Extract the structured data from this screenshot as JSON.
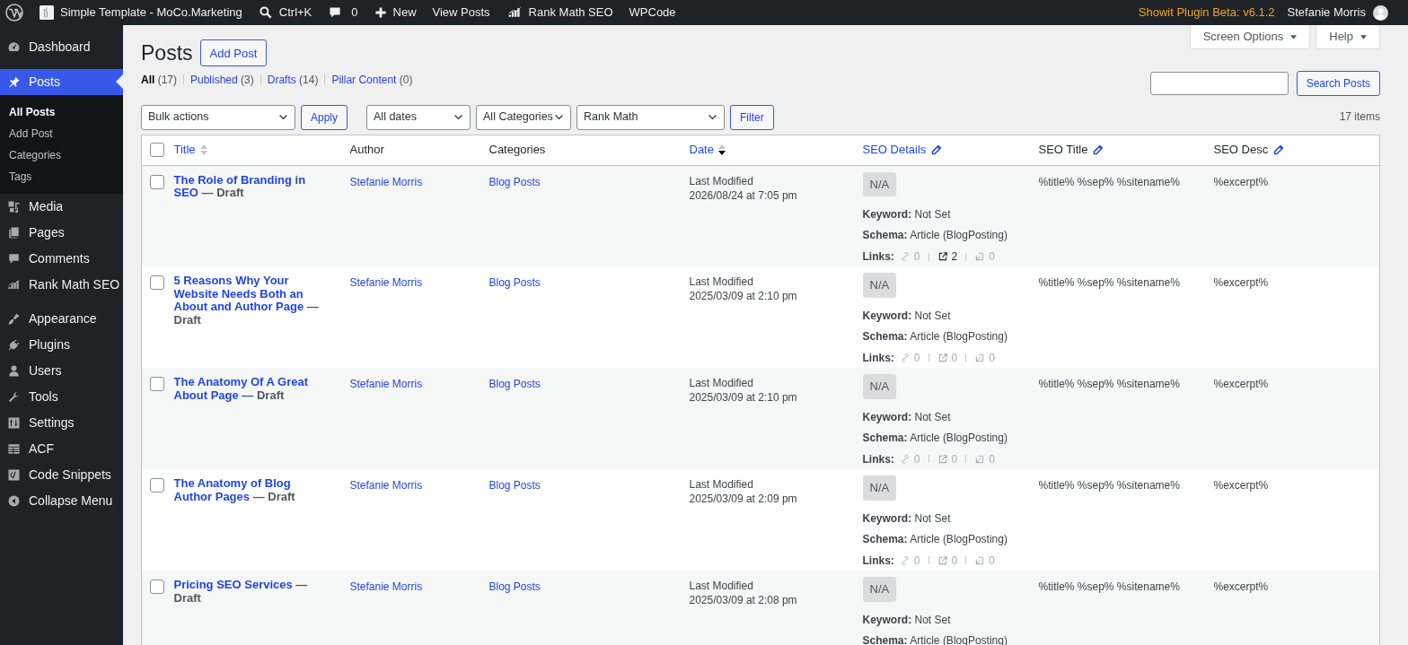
{
  "admin_bar": {
    "items": [
      {
        "kind": "wp-logo"
      },
      {
        "kind": "site",
        "label": "Simple Template - MoCo.Marketing"
      },
      {
        "kind": "search",
        "label": "Ctrl+K"
      },
      {
        "kind": "comments",
        "label": "0"
      },
      {
        "kind": "new",
        "label": "New"
      },
      {
        "kind": "text",
        "label": "View Posts"
      },
      {
        "kind": "rankmath",
        "label": "Rank Math SEO"
      },
      {
        "kind": "text",
        "label": "WPCode"
      }
    ],
    "notice": "Showit Plugin Beta: v6.1.2",
    "user": "Stefanie Morris"
  },
  "sidebar": {
    "groups": [
      {
        "items": [
          {
            "kind": "dashboard",
            "label": "Dashboard",
            "selected": false
          }
        ]
      },
      {
        "items": [
          {
            "kind": "pin",
            "label": "Posts",
            "selected": true,
            "submenu": [
              {
                "label": "All Posts",
                "selected": true
              },
              {
                "label": "Add Post",
                "selected": false
              },
              {
                "label": "Categories",
                "selected": false
              },
              {
                "label": "Tags",
                "selected": false
              }
            ]
          },
          {
            "kind": "media",
            "label": "Media",
            "selected": false
          },
          {
            "kind": "pages",
            "label": "Pages",
            "selected": false
          },
          {
            "kind": "comments",
            "label": "Comments",
            "selected": false
          },
          {
            "kind": "rankmath",
            "label": "Rank Math SEO",
            "selected": false
          }
        ]
      },
      {
        "items": [
          {
            "kind": "appearance",
            "label": "Appearance",
            "selected": false
          },
          {
            "kind": "plugins",
            "label": "Plugins",
            "selected": false
          },
          {
            "kind": "users",
            "label": "Users",
            "selected": false
          },
          {
            "kind": "tools",
            "label": "Tools",
            "selected": false
          },
          {
            "kind": "settings",
            "label": "Settings",
            "selected": false
          },
          {
            "kind": "acf",
            "label": "ACF",
            "selected": false
          },
          {
            "kind": "code",
            "label": "Code Snippets",
            "selected": false
          },
          {
            "kind": "collapse",
            "label": "Collapse Menu",
            "selected": false
          }
        ]
      }
    ]
  },
  "screen_tabs": [
    "Screen Options",
    "Help"
  ],
  "page_title": "Posts",
  "add_button": "Add Post",
  "status_filters": [
    {
      "label": "All",
      "count": "(17)",
      "selected": true
    },
    {
      "label": "Published",
      "count": "(3)",
      "selected": false
    },
    {
      "label": "Drafts",
      "count": "(14)",
      "selected": false
    },
    {
      "label": "Pillar Content",
      "count": "(0)",
      "selected": false
    }
  ],
  "search_button": "Search Posts",
  "toolbar": {
    "bulk": "Bulk actions",
    "apply": "Apply",
    "dates": "All dates",
    "categories": "All Categories",
    "rank_math": "Rank Math",
    "filter": "Filter",
    "count": "17 items"
  },
  "table": {
    "select_all_checked": false,
    "columns": [
      {
        "label": "Title",
        "link": true,
        "sortable": true,
        "sorted": false,
        "edit": false
      },
      {
        "label": "Author",
        "link": false,
        "sortable": false,
        "edit": false
      },
      {
        "label": "Categories",
        "link": false,
        "sortable": false,
        "edit": false
      },
      {
        "label": "Date",
        "link": true,
        "sortable": true,
        "sorted": true,
        "edit": false
      },
      {
        "label": "SEO Details",
        "link": true,
        "sortable": false,
        "edit": true
      },
      {
        "label": "SEO Title",
        "link": false,
        "sortable": false,
        "edit": true
      },
      {
        "label": "SEO Desc",
        "link": false,
        "sortable": false,
        "edit": true
      }
    ],
    "rows": [
      {
        "checked": false,
        "title": "The Role of Branding in SEO",
        "state": "— Draft",
        "author": "Stefanie Morris",
        "category": "Blog Posts",
        "date_label": "Last Modified",
        "date": "2026/08/24 at 7:05 pm",
        "score": "N/A",
        "keyword": "**Keyword:** Not Set",
        "schema": "**Schema:** Article (BlogPosting)",
        "links_label": "Links:",
        "links": [
          {
            "kind": "internal",
            "count": "0",
            "active": false
          },
          {
            "kind": "external",
            "count": "2",
            "active": true
          },
          {
            "kind": "incoming",
            "count": "0",
            "active": false
          }
        ],
        "seo_title": "%title% %sep% %sitename%",
        "seo_desc": "%excerpt%"
      },
      {
        "checked": false,
        "title": "5 Reasons Why Your Website Needs Both an About and Author Page",
        "state": "— Draft",
        "author": "Stefanie Morris",
        "category": "Blog Posts",
        "date_label": "Last Modified",
        "date": "2025/03/09 at 2:10 pm",
        "score": "N/A",
        "keyword": "**Keyword:** Not Set",
        "schema": "**Schema:** Article (BlogPosting)",
        "links_label": "Links:",
        "links": [
          {
            "kind": "internal",
            "count": "0",
            "active": false
          },
          {
            "kind": "external",
            "count": "0",
            "active": false
          },
          {
            "kind": "incoming",
            "count": "0",
            "active": false
          }
        ],
        "seo_title": "%title% %sep% %sitename%",
        "seo_desc": "%excerpt%"
      },
      {
        "checked": false,
        "title": "The Anatomy Of A Great About Page",
        "state": "— Draft",
        "author": "Stefanie Morris",
        "category": "Blog Posts",
        "date_label": "Last Modified",
        "date": "2025/03/09 at 2:10 pm",
        "score": "N/A",
        "keyword": "**Keyword:** Not Set",
        "schema": "**Schema:** Article (BlogPosting)",
        "links_label": "Links:",
        "links": [
          {
            "kind": "internal",
            "count": "0",
            "active": false
          },
          {
            "kind": "external",
            "count": "0",
            "active": false
          },
          {
            "kind": "incoming",
            "count": "0",
            "active": false
          }
        ],
        "seo_title": "%title% %sep% %sitename%",
        "seo_desc": "%excerpt%"
      },
      {
        "checked": false,
        "title": "The Anatomy of Blog Author Pages",
        "state": "— Draft",
        "author": "Stefanie Morris",
        "category": "Blog Posts",
        "date_label": "Last Modified",
        "date": "2025/03/09 at 2:09 pm",
        "score": "N/A",
        "keyword": "**Keyword:** Not Set",
        "schema": "**Schema:** Article (BlogPosting)",
        "links_label": "Links:",
        "links": [
          {
            "kind": "internal",
            "count": "0",
            "active": false
          },
          {
            "kind": "external",
            "count": "0",
            "active": false
          },
          {
            "kind": "incoming",
            "count": "0",
            "active": false
          }
        ],
        "seo_title": "%title% %sep% %sitename%",
        "seo_desc": "%excerpt%"
      },
      {
        "checked": false,
        "title": "Pricing SEO Services",
        "state": "— Draft",
        "author": "Stefanie Morris",
        "category": "Blog Posts",
        "date_label": "Last Modified",
        "date": "2025/03/09 at 2:08 pm",
        "score": "N/A",
        "keyword": "**Keyword:** Not Set",
        "schema": "**Schema:** Article (BlogPosting)",
        "seo_title": "%title% %sep% %sitename%",
        "seo_desc": "%excerpt%"
      }
    ]
  }
}
